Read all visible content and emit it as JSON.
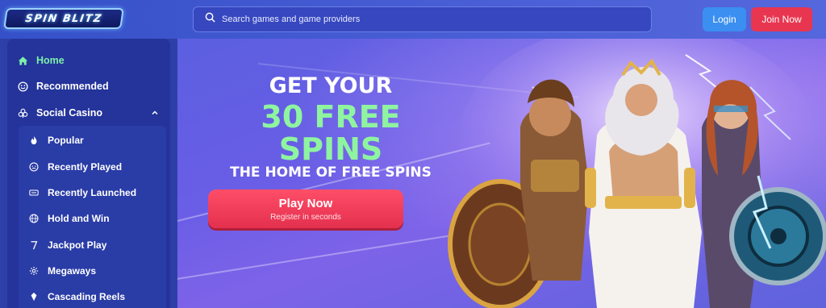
{
  "header": {
    "logo_text": "SPIN BLITZ",
    "search_placeholder": "Search games and game providers",
    "login_label": "Login",
    "join_label": "Join Now"
  },
  "sidebar": {
    "items": [
      {
        "label": "Home",
        "icon": "home-icon"
      },
      {
        "label": "Recommended",
        "icon": "smile-icon"
      },
      {
        "label": "Social Casino",
        "icon": "clubs-icon"
      }
    ],
    "submenu": [
      {
        "label": "Popular",
        "icon": "flame-icon"
      },
      {
        "label": "Recently Played",
        "icon": "clock-face-icon"
      },
      {
        "label": "Recently Launched",
        "icon": "new-badge-icon"
      },
      {
        "label": "Hold and Win",
        "icon": "globe-icon"
      },
      {
        "label": "Jackpot Play",
        "icon": "seven-icon"
      },
      {
        "label": "Megaways",
        "icon": "gear-icon"
      },
      {
        "label": "Cascading Reels",
        "icon": "gem-icon"
      }
    ]
  },
  "banner": {
    "line1": "GET YOUR",
    "line2": "30 FREE",
    "line3": "SPINS",
    "line4": "THE HOME OF FREE SPINS",
    "cta_label": "Play Now",
    "cta_sub": "Register in seconds"
  },
  "colors": {
    "accent_green": "#8ef4a0",
    "cta_red": "#e83650",
    "login_blue": "#3b8ff0",
    "sidebar_bg": "#24349b"
  }
}
